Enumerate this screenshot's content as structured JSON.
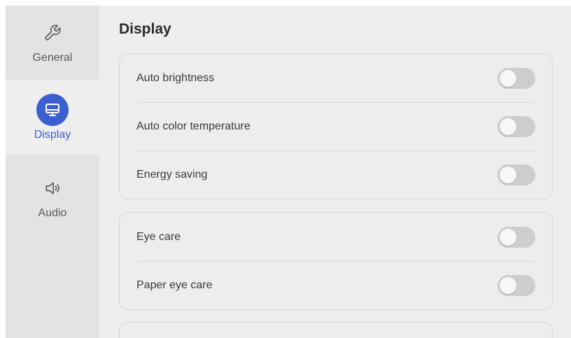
{
  "sidebar": {
    "items": [
      {
        "label": "General",
        "icon": "wrench-icon",
        "active": false
      },
      {
        "label": "Display",
        "icon": "monitor-icon",
        "active": true
      },
      {
        "label": "Audio",
        "icon": "speaker-icon",
        "active": false
      }
    ]
  },
  "page": {
    "title": "Display"
  },
  "groups": [
    {
      "rows": [
        {
          "label": "Auto brightness",
          "enabled": false
        },
        {
          "label": "Auto color temperature",
          "enabled": false
        },
        {
          "label": "Energy saving",
          "enabled": false
        }
      ]
    },
    {
      "rows": [
        {
          "label": "Eye care",
          "enabled": false
        },
        {
          "label": "Paper eye care",
          "enabled": false
        }
      ]
    }
  ],
  "colors": {
    "accent": "#3c5fcf",
    "sidebar_bg": "#e3e3e3",
    "content_bg": "#eeeeee",
    "toggle_off": "#cdcdcd"
  }
}
